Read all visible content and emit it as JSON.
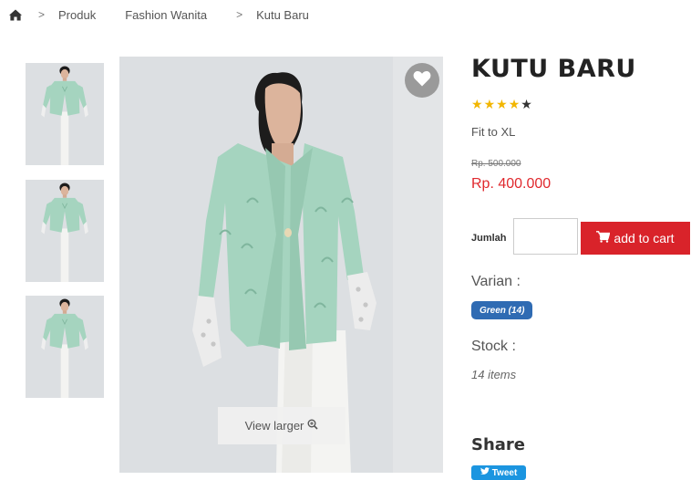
{
  "breadcrumb": {
    "separator": ">",
    "items": [
      "Produk",
      "Fashion Wanita",
      "Kutu Baru"
    ]
  },
  "product": {
    "title": "KUTU BARU",
    "rating": 4,
    "rating_max": 5,
    "fit": "Fit to XL",
    "old_price": "Rp. 500.000",
    "price": "Rp. 400.000",
    "variants_label": "Varian :",
    "variant": "Green (14)",
    "stock_label": "Stock :",
    "stock_value": "14 items"
  },
  "cart": {
    "quantity_label": "Jumlah",
    "quantity_value": "",
    "add_label": "add to cart"
  },
  "gallery": {
    "view_larger_label": "View larger",
    "thumbnail_count": 3
  },
  "share": {
    "label": "Share",
    "tweet_label": "Tweet"
  },
  "colors": {
    "price_red": "#e0292e",
    "cart_red": "#d9232a",
    "badge_blue": "#2f6bb3",
    "star_gold": "#f2b600",
    "twitter_blue": "#1b95e0",
    "jacket_mint": "#a5d4bf"
  }
}
